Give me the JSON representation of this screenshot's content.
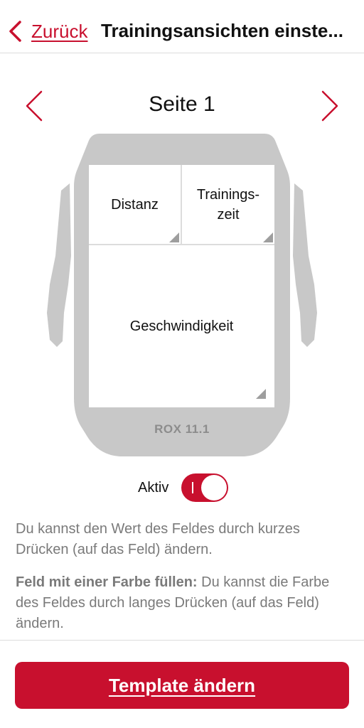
{
  "header": {
    "back_label": "Zurück",
    "title": "Trainingsansichten einste..."
  },
  "page_selector": {
    "title": "Seite 1"
  },
  "device": {
    "model": "ROX 11.1",
    "fields": {
      "distance": "Distanz",
      "training_time_line1": "Trainings-",
      "training_time_line2": "zeit",
      "speed": "Geschwindigkeit"
    }
  },
  "active_toggle": {
    "label": "Aktiv",
    "state": "on"
  },
  "info": {
    "text1": "Du kannst den Wert des Feldes durch kurzes Drücken (auf das Feld) ändern.",
    "text2_bold": "Feld mit einer Farbe füllen:",
    "text2": " Du kannst die Farbe des Feldes durch langes Drücken (auf das Feld) ändern."
  },
  "template_button": {
    "label": "Template ändern"
  },
  "colors": {
    "accent": "#c8102e",
    "device_body": "#c8c8c8",
    "muted_text": "#7a7a7a"
  }
}
